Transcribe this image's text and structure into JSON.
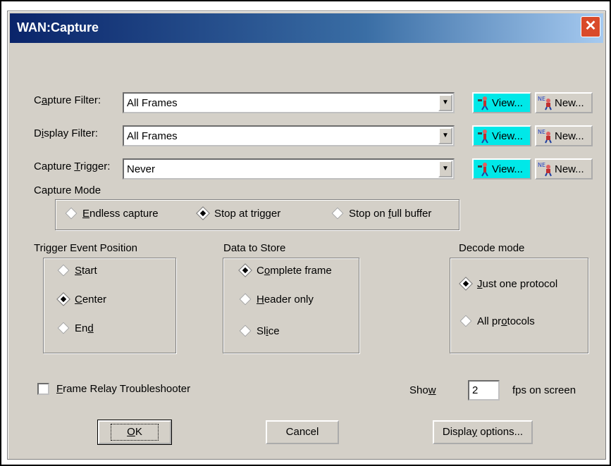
{
  "window": {
    "title": "WAN:Capture"
  },
  "filters": [
    {
      "label_pre": "C",
      "label_ul": "a",
      "label_post": "pture Filter:",
      "value": "All Frames"
    },
    {
      "label_pre": "D",
      "label_ul": "i",
      "label_post": "splay Filter:",
      "value": "All Frames"
    },
    {
      "label_pre": "Capture ",
      "label_ul": "T",
      "label_post": "rigger:",
      "value": "Never"
    }
  ],
  "buttons": {
    "view": "View...",
    "new": "New..."
  },
  "capture_mode": {
    "title": "Capture Mode",
    "options": [
      {
        "pre": "",
        "ul": "E",
        "post": "ndless capture",
        "selected": false
      },
      {
        "pre": "Stop at trigger",
        "ul": "",
        "post": "",
        "selected": true
      },
      {
        "pre": "Stop on ",
        "ul": "f",
        "post": "ull buffer",
        "selected": false
      }
    ]
  },
  "trigger_position": {
    "title": "Trigger Event Position",
    "options": [
      {
        "pre": "",
        "ul": "S",
        "post": "tart",
        "selected": false
      },
      {
        "pre": "",
        "ul": "C",
        "post": "enter",
        "selected": true
      },
      {
        "pre": "En",
        "ul": "d",
        "post": "",
        "selected": false
      }
    ]
  },
  "data_to_store": {
    "title": "Data to Store",
    "options": [
      {
        "pre": "C",
        "ul": "o",
        "post": "mplete frame",
        "selected": true
      },
      {
        "pre": "",
        "ul": "H",
        "post": "eader only",
        "selected": false
      },
      {
        "pre": "Sl",
        "ul": "i",
        "post": "ce",
        "selected": false
      }
    ]
  },
  "decode_mode": {
    "title": "Decode mode",
    "options": [
      {
        "pre": "",
        "ul": "J",
        "post": "ust one protocol",
        "selected": true
      },
      {
        "pre": "All pr",
        "ul": "o",
        "post": "tocols",
        "selected": false
      }
    ]
  },
  "frame_relay": {
    "ul": "F",
    "post": "rame Relay Troubleshooter",
    "checked": false
  },
  "show": {
    "label_pre": "Sho",
    "label_ul": "w",
    "value": "2",
    "suffix": "fps on screen"
  },
  "dialog_buttons": {
    "ok_ul": "O",
    "ok_post": "K",
    "cancel": "Cancel",
    "display_pre": "Displa",
    "display_ul": "y",
    "display_post": " options..."
  }
}
